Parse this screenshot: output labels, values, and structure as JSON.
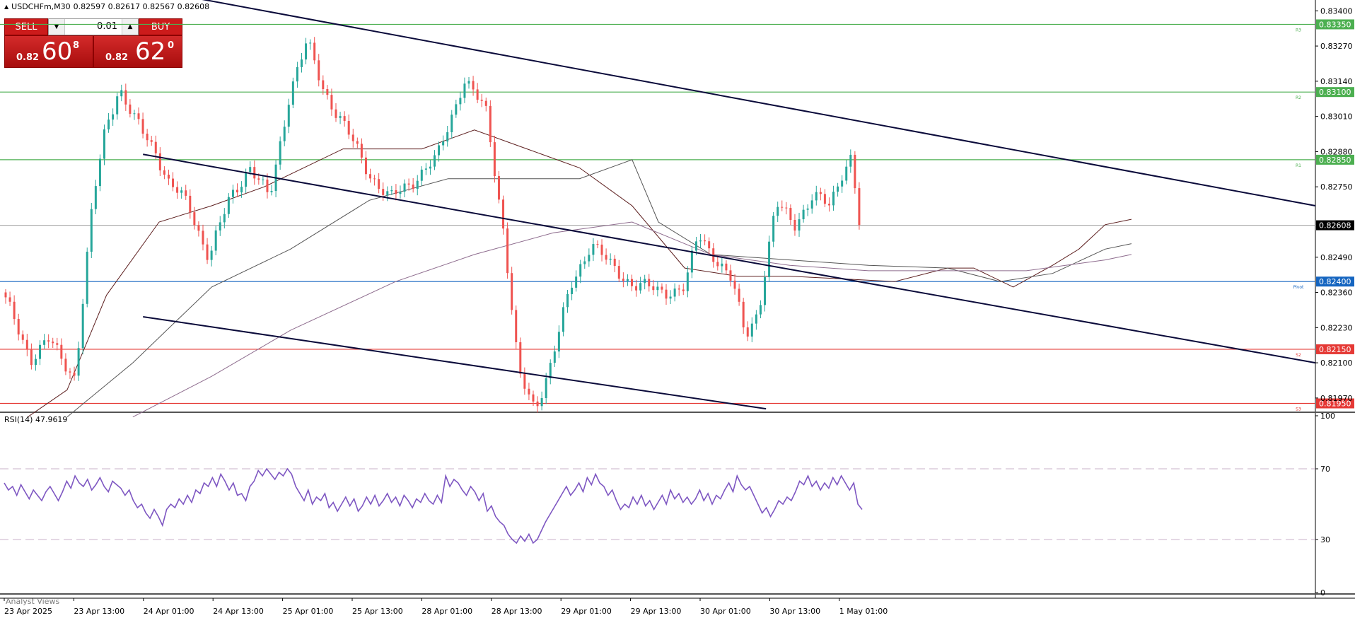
{
  "header": {
    "symbol_label": "USDCHFm,M30",
    "ohlc": "0.82597 0.82617 0.82567 0.82608"
  },
  "trade_panel": {
    "sell_label": "SELL",
    "buy_label": "BUY",
    "lot_value": "0.01",
    "sell_price": {
      "prefix": "0.82",
      "big": "60",
      "sup": "8"
    },
    "buy_price": {
      "prefix": "0.82",
      "big": "62",
      "sup": "0"
    },
    "colors": {
      "button": "#cc1b1b"
    }
  },
  "footer": {
    "analyst_label": "Analyst Views"
  },
  "chart_data": [
    {
      "type": "candlestick",
      "symbol": "USDCHFm",
      "timeframe": "M30",
      "ylim": [
        0.8192,
        0.8344
      ],
      "y_ticks": [
        "0.83400",
        "0.83270",
        "0.83140",
        "0.83010",
        "0.82880",
        "0.82750",
        "0.82490",
        "0.82360",
        "0.82230",
        "0.82100",
        "0.81970"
      ],
      "x_ticks": [
        "23 Apr 2025",
        "23 Apr 13:00",
        "24 Apr 01:00",
        "24 Apr 13:00",
        "25 Apr 01:00",
        "25 Apr 13:00",
        "28 Apr 01:00",
        "28 Apr 13:00",
        "29 Apr 01:00",
        "29 Apr 13:00",
        "30 Apr 01:00",
        "30 Apr 13:00",
        "1 May 01:00"
      ],
      "current_price": {
        "value": 0.82608,
        "label": "0.82608",
        "color": "#000000"
      },
      "pivot_levels": [
        {
          "name": "R3",
          "value": 0.8335,
          "label": "0.83350",
          "color": "#4caf50"
        },
        {
          "name": "R2",
          "value": 0.831,
          "label": "0.83100",
          "color": "#4caf50"
        },
        {
          "name": "R1",
          "value": 0.8285,
          "label": "0.82850",
          "color": "#4caf50"
        },
        {
          "name": "Pivot",
          "value": 0.824,
          "label": "0.82400",
          "color": "#1565c0"
        },
        {
          "name": "S2",
          "value": 0.8215,
          "label": "0.82150",
          "color": "#e53935"
        },
        {
          "name": "S3",
          "value": 0.8195,
          "label": "0.81950",
          "color": "#e53935"
        }
      ],
      "trendlines": [
        {
          "from": [
            "2025-04-22 21:00",
            0.8358
          ],
          "to": [
            "2025-05-02 13:00",
            0.8268
          ]
        },
        {
          "from": [
            "2025-04-23 22:00",
            0.8287
          ],
          "to": [
            "2025-05-02 13:00",
            0.821
          ]
        },
        {
          "from": [
            "2025-04-23 22:00",
            0.8227
          ],
          "to": [
            "2025-04-28 12:00",
            0.8193
          ]
        }
      ],
      "series": [
        {
          "type": "moving_average",
          "color": "#5d1f1f",
          "points": [
            [
              0.02,
              0.819
            ],
            [
              0.05,
              0.82
            ],
            [
              0.08,
              0.8235
            ],
            [
              0.12,
              0.8262
            ],
            [
              0.16,
              0.8268
            ],
            [
              0.2,
              0.8275
            ],
            [
              0.26,
              0.8289
            ],
            [
              0.32,
              0.8289
            ],
            [
              0.36,
              0.8296
            ],
            [
              0.4,
              0.8289
            ],
            [
              0.44,
              0.8282
            ],
            [
              0.48,
              0.8268
            ],
            [
              0.52,
              0.8245
            ],
            [
              0.56,
              0.8242
            ],
            [
              0.6,
              0.8242
            ],
            [
              0.64,
              0.8241
            ],
            [
              0.68,
              0.824
            ],
            [
              0.72,
              0.8245
            ],
            [
              0.74,
              0.8245
            ],
            [
              0.77,
              0.8238
            ],
            [
              0.8,
              0.8246
            ],
            [
              0.82,
              0.8252
            ],
            [
              0.84,
              0.8261
            ],
            [
              0.86,
              0.8263
            ]
          ]
        },
        {
          "type": "moving_average",
          "color": "#555555",
          "points": [
            [
              0.05,
              0.819
            ],
            [
              0.1,
              0.821
            ],
            [
              0.16,
              0.8238
            ],
            [
              0.22,
              0.8252
            ],
            [
              0.28,
              0.827
            ],
            [
              0.34,
              0.8278
            ],
            [
              0.4,
              0.8278
            ],
            [
              0.44,
              0.8278
            ],
            [
              0.48,
              0.8285
            ],
            [
              0.5,
              0.8262
            ],
            [
              0.54,
              0.825
            ],
            [
              0.6,
              0.8248
            ],
            [
              0.66,
              0.8246
            ],
            [
              0.72,
              0.8245
            ],
            [
              0.76,
              0.824
            ],
            [
              0.8,
              0.8243
            ],
            [
              0.84,
              0.8252
            ],
            [
              0.86,
              0.8254
            ]
          ]
        },
        {
          "type": "moving_average",
          "color": "#8e6c8e",
          "points": [
            [
              0.1,
              0.819
            ],
            [
              0.16,
              0.8205
            ],
            [
              0.22,
              0.8222
            ],
            [
              0.3,
              0.824
            ],
            [
              0.36,
              0.825
            ],
            [
              0.42,
              0.8258
            ],
            [
              0.48,
              0.8262
            ],
            [
              0.54,
              0.825
            ],
            [
              0.6,
              0.8246
            ],
            [
              0.66,
              0.8244
            ],
            [
              0.72,
              0.8244
            ],
            [
              0.78,
              0.8244
            ],
            [
              0.84,
              0.8248
            ],
            [
              0.86,
              0.825
            ]
          ]
        }
      ]
    },
    {
      "type": "line",
      "title": "RSI(14) 47.9619",
      "ylim": [
        0,
        100
      ],
      "y_ticks": [
        "100",
        "70",
        "30",
        "0"
      ],
      "levels": [
        70,
        30
      ],
      "series": [
        {
          "color": "#7e57c2",
          "values": [
            62,
            58,
            60,
            55,
            61,
            57,
            53,
            58,
            55,
            52,
            57,
            60,
            56,
            52,
            57,
            63,
            59,
            66,
            62,
            60,
            64,
            58,
            61,
            65,
            60,
            57,
            63,
            61,
            59,
            55,
            58,
            52,
            48,
            50,
            45,
            42,
            47,
            43,
            38,
            47,
            50,
            48,
            53,
            50,
            55,
            51,
            58,
            56,
            62,
            60,
            65,
            60,
            67,
            63,
            58,
            62,
            55,
            56,
            52,
            60,
            63,
            69,
            66,
            70,
            67,
            64,
            68,
            66,
            70,
            67,
            60,
            56,
            52,
            58,
            50,
            54,
            52,
            56,
            48,
            51,
            46,
            50,
            54,
            49,
            53,
            46,
            49,
            54,
            50,
            55,
            49,
            52,
            56,
            51,
            54,
            49,
            55,
            52,
            48,
            53,
            51,
            56,
            52,
            50,
            55,
            51,
            66,
            60,
            64,
            62,
            58,
            55,
            60,
            57,
            52,
            56,
            46,
            49,
            43,
            40,
            38,
            33,
            30,
            28,
            32,
            29,
            33,
            28,
            30,
            35,
            40,
            44,
            48,
            52,
            56,
            60,
            55,
            58,
            62,
            57,
            65,
            61,
            67,
            62,
            60,
            55,
            58,
            52,
            47,
            50,
            48,
            54,
            50,
            55,
            49,
            52,
            47,
            51,
            55,
            50,
            58,
            53,
            56,
            51,
            54,
            50,
            53,
            58,
            52,
            56,
            50,
            55,
            53,
            58,
            62,
            57,
            66,
            61,
            58,
            60,
            55,
            50,
            45,
            48,
            43,
            47,
            52,
            50,
            54,
            52,
            57,
            63,
            61,
            66,
            60,
            63,
            58,
            62,
            59,
            65,
            61,
            66,
            62,
            58,
            62,
            50,
            47
          ]
        }
      ]
    }
  ]
}
